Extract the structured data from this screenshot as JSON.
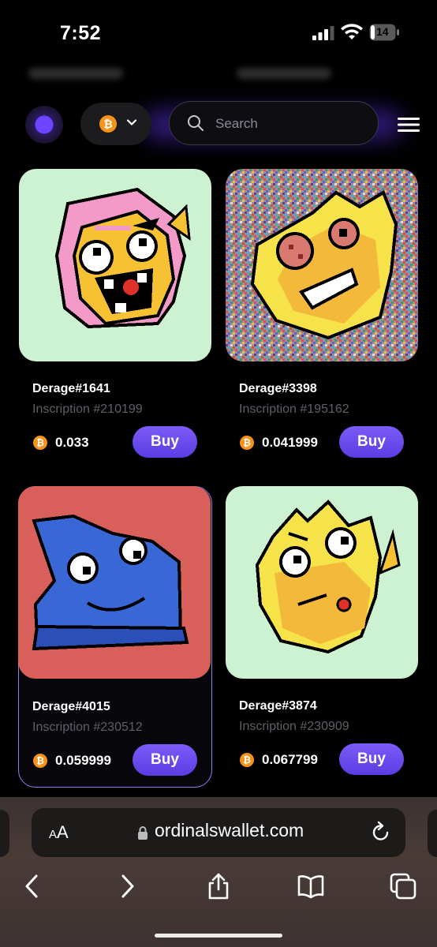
{
  "status_bar": {
    "time": "7:52",
    "battery_level": "14"
  },
  "header": {
    "chain_icon": "bitcoin-icon",
    "search": {
      "placeholder": "Search",
      "value": ""
    },
    "menu_icon": "hamburger-menu-icon"
  },
  "cards": [
    {
      "name": "Derage#1641",
      "inscription": "Inscription #210199",
      "price": "0.033",
      "buy_label": "Buy"
    },
    {
      "name": "Derage#3398",
      "inscription": "Inscription #195162",
      "price": "0.041999",
      "buy_label": "Buy"
    },
    {
      "name": "Derage#4015",
      "inscription": "Inscription #230512",
      "price": "0.059999",
      "buy_label": "Buy"
    },
    {
      "name": "Derage#3874",
      "inscription": "Inscription #230909",
      "price": "0.067799",
      "buy_label": "Buy"
    }
  ],
  "browser": {
    "reader_label_big": "A",
    "reader_label_small": "A",
    "url": "ordinalswallet.com"
  },
  "colors": {
    "accent": "#6a4bf0",
    "bitcoin": "#f7931a",
    "card1_bg": "#cdf2d2",
    "card3_bg": "#d9605a",
    "card4_bg": "#cdf2d2"
  }
}
